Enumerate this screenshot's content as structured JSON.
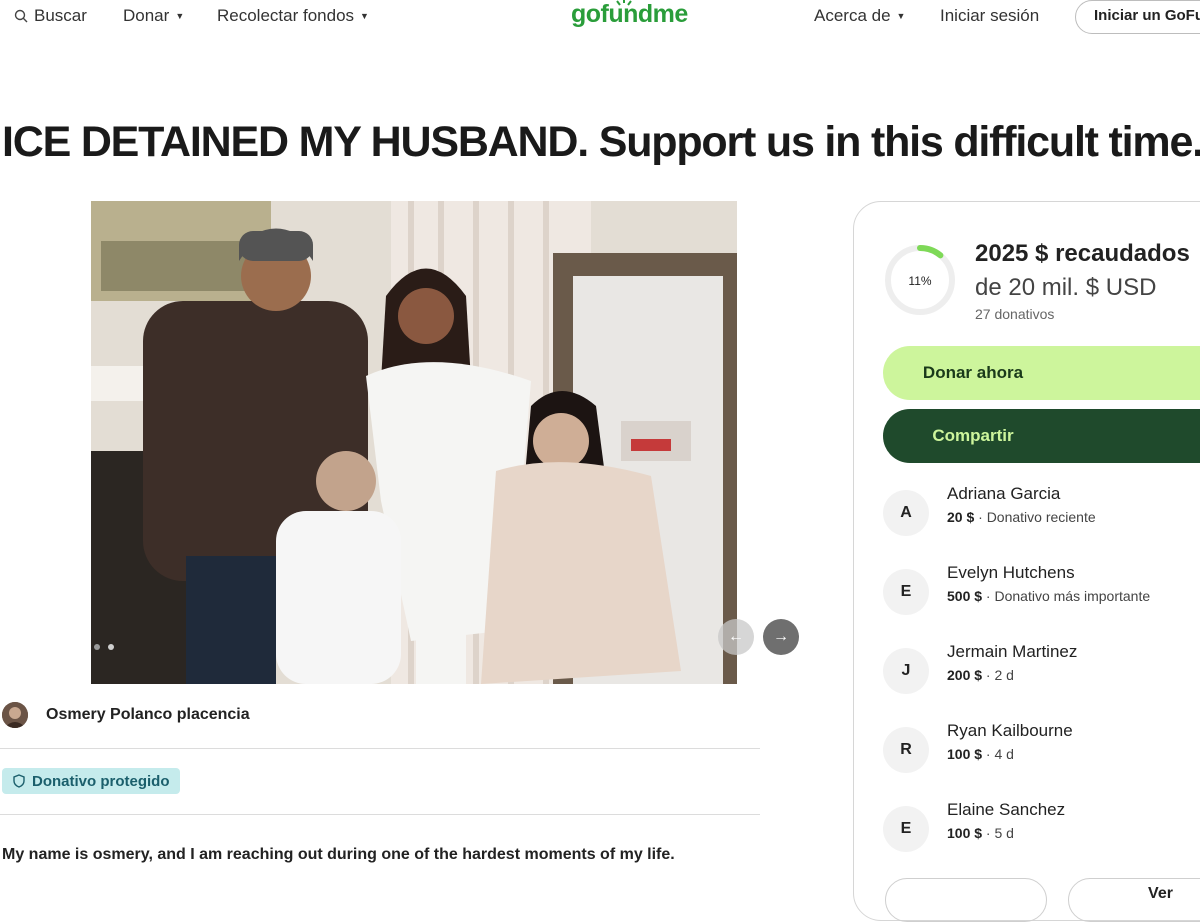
{
  "header": {
    "search_label": "Buscar",
    "donate_label": "Donar",
    "fundraise_label": "Recolectar fondos",
    "logo_text": "gofundme",
    "about_label": "Acerca de",
    "login_label": "Iniciar sesión",
    "start_label": "Iniciar un GoFundMe"
  },
  "campaign": {
    "title": "ICE DETAINED MY HUSBAND. Support us in this difficult time.",
    "organizer": "Osmery Polanco placencia",
    "protected_label": "Donativo protegido",
    "story_first_line": "My name is osmery, and I am reaching out during one of the hardest moments of my life."
  },
  "progress": {
    "percent_label": "11%",
    "percent_value": 0.11,
    "raised": "2025 $ recaudados",
    "goal": "de 20 mil. $ USD",
    "donations_count": "27 donativos"
  },
  "actions": {
    "donate_now": "Donar ahora",
    "share": "Compartir",
    "see_all": "Ver"
  },
  "donors": [
    {
      "initial": "A",
      "name": "Adriana Garcia",
      "amount": "20 $",
      "note": " · Donativo reciente"
    },
    {
      "initial": "E",
      "name": "Evelyn Hutchens",
      "amount": "500 $",
      "note": " · Donativo más importante"
    },
    {
      "initial": "J",
      "name": "Jermain Martinez",
      "amount": "200 $",
      "note": " · 2 d"
    },
    {
      "initial": "R",
      "name": "Ryan Kailbourne",
      "amount": "100 $",
      "note": " · 4 d"
    },
    {
      "initial": "E",
      "name": "Elaine Sanchez",
      "amount": "100 $",
      "note": " · 5 d"
    }
  ],
  "colors": {
    "brand": "#2a9d3a",
    "donate_bg": "#cdf59c",
    "share_bg": "#1f4a2c",
    "progress_ring": "#7ed957"
  },
  "icons": {
    "search": "search-icon",
    "shield": "shield-icon",
    "next": "arrow-right-icon",
    "prev": "arrow-left-icon"
  }
}
